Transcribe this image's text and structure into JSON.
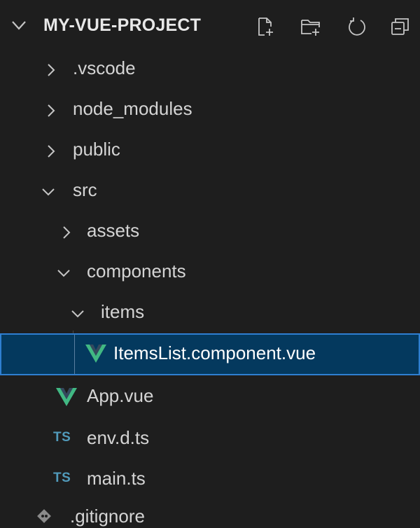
{
  "explorer": {
    "project_title": "MY-VUE-PROJECT",
    "toolbar": {
      "new_file": "new-file-icon",
      "new_folder": "new-folder-icon",
      "refresh": "refresh-icon",
      "collapse_all": "collapse-all-icon"
    },
    "items": [
      {
        "label": ".vscode",
        "type": "folder",
        "expanded": false
      },
      {
        "label": "node_modules",
        "type": "folder",
        "expanded": false
      },
      {
        "label": "public",
        "type": "folder",
        "expanded": false
      },
      {
        "label": "src",
        "type": "folder",
        "expanded": true
      },
      {
        "label": "assets",
        "type": "folder",
        "expanded": false
      },
      {
        "label": "components",
        "type": "folder",
        "expanded": true
      },
      {
        "label": "items",
        "type": "folder",
        "expanded": true
      },
      {
        "label": "ItemsList.component.vue",
        "type": "vue-file",
        "selected": true
      },
      {
        "label": "App.vue",
        "type": "vue-file"
      },
      {
        "label": "env.d.ts",
        "type": "ts-file"
      },
      {
        "label": "main.ts",
        "type": "ts-file"
      },
      {
        "label": ".gitignore",
        "type": "git-file"
      }
    ],
    "ts_badge": "TS",
    "colors": {
      "background": "#1e1e1e",
      "selection_background": "#04395e",
      "selection_border": "#2f7fd1",
      "vue_green": "#41b883",
      "ts_blue": "#519aba"
    }
  }
}
